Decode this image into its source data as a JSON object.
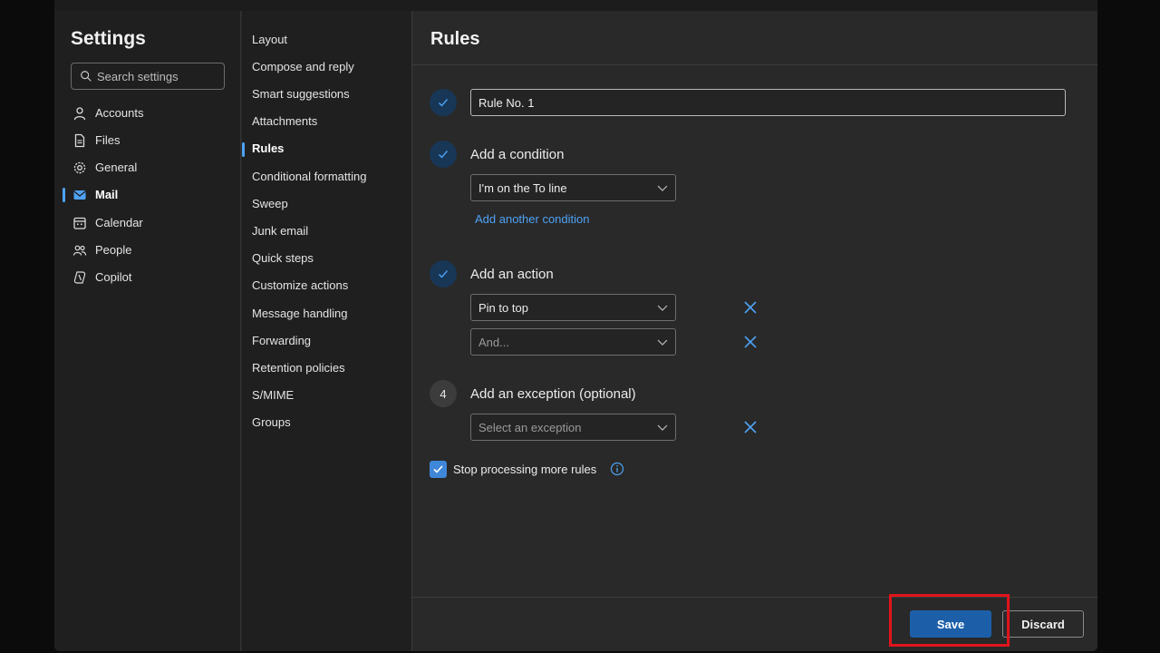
{
  "nav": {
    "title": "Settings",
    "search_placeholder": "Search settings",
    "items": [
      {
        "label": "Accounts",
        "icon": "person-icon"
      },
      {
        "label": "Files",
        "icon": "file-icon"
      },
      {
        "label": "General",
        "icon": "gear-icon"
      },
      {
        "label": "Mail",
        "icon": "mail-icon",
        "active": true
      },
      {
        "label": "Calendar",
        "icon": "calendar-icon"
      },
      {
        "label": "People",
        "icon": "people-icon"
      },
      {
        "label": "Copilot",
        "icon": "copilot-icon"
      }
    ]
  },
  "subnav": {
    "items": [
      "Layout",
      "Compose and reply",
      "Smart suggestions",
      "Attachments",
      "Rules",
      "Conditional formatting",
      "Sweep",
      "Junk email",
      "Quick steps",
      "Customize actions",
      "Message handling",
      "Forwarding",
      "Retention policies",
      "S/MIME",
      "Groups"
    ],
    "active": "Rules"
  },
  "main": {
    "title": "Rules",
    "rule_name": "Rule No. 1",
    "condition": {
      "label": "Add a condition",
      "selected": "I'm on the To line",
      "add_link": "Add another condition"
    },
    "action": {
      "label": "Add an action",
      "selected": "Pin to top",
      "second_placeholder": "And..."
    },
    "exception": {
      "step": "4",
      "label": "Add an exception (optional)",
      "placeholder": "Select an exception"
    },
    "stop_processing": {
      "label": "Stop processing more rules",
      "checked": true
    },
    "save_label": "Save",
    "discard_label": "Discard"
  },
  "colors": {
    "accent": "#4ea2f5",
    "primary_button": "#1c5fa8",
    "highlight": "#e1141b"
  }
}
